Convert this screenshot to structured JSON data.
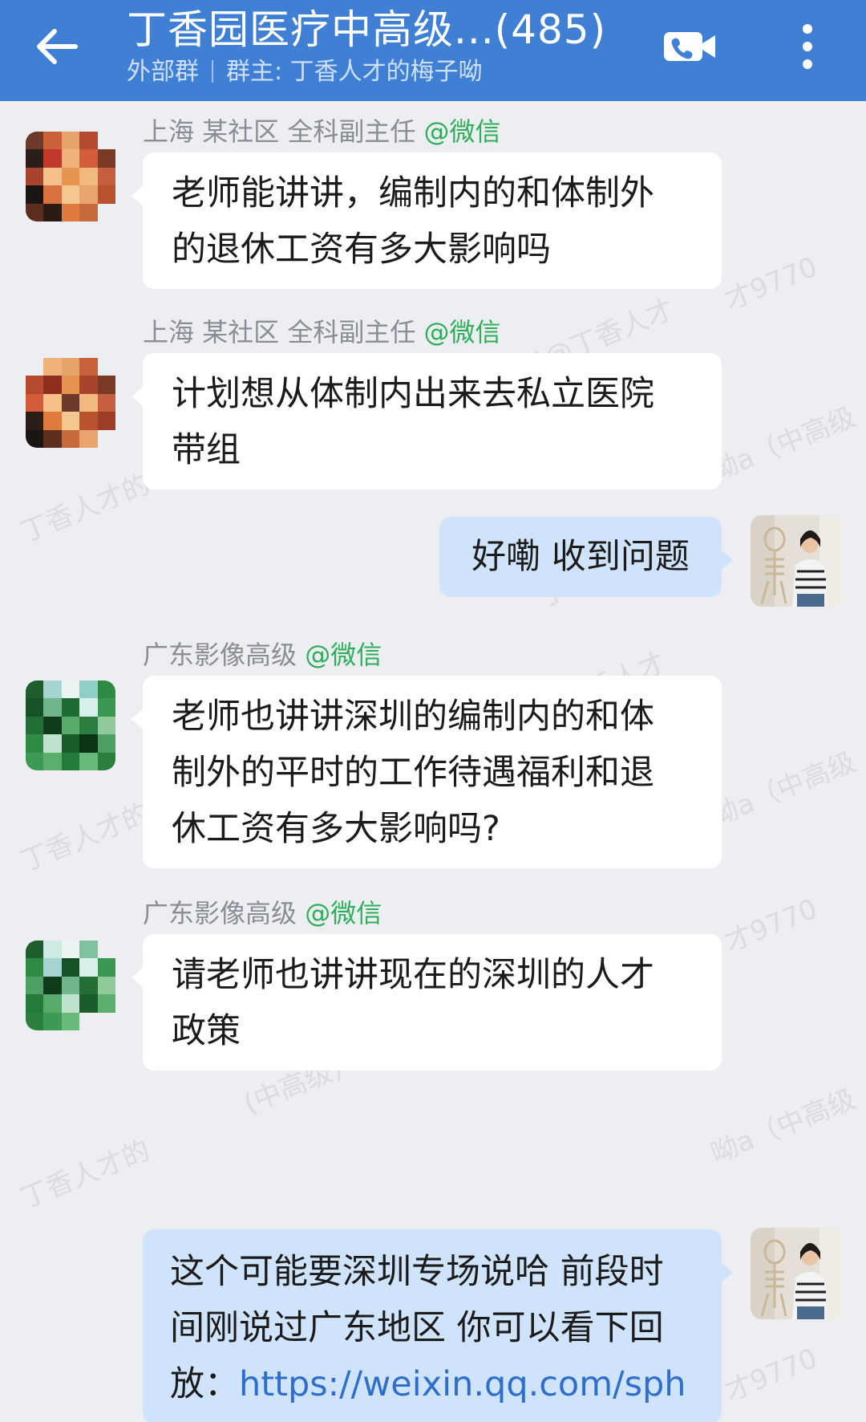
{
  "header": {
    "title": "丁香园医疗中高级...(485)",
    "group_type": "外部群",
    "owner": "群主: 丁香人才的梅子呦",
    "back_icon": "arrow-left-icon",
    "video_icon": "video-call-icon",
    "more_icon": "more-vertical-icon"
  },
  "watermark": {
    "lines": [
      "丁香人才的",
      "的梅子呦)@丁香人才",
      "才9770",
      "呦a（中高级",
      "丁香",
      "(中高级)"
    ]
  },
  "messages": [
    {
      "sender": "上海 某社区 全科副主任",
      "tag": "@微信",
      "text_lines": [
        "老师能讲讲，编制内的和体制外",
        "的退休工资有多大影响吗"
      ]
    },
    {
      "sender": "上海 某社区 全科副主任",
      "tag": "@微信",
      "text_lines": [
        "计划想从体制内出来去私立医院",
        "带组"
      ]
    },
    {
      "text": "好嘞 收到问题"
    },
    {
      "sender": "广东影像高级",
      "tag": "@微信",
      "text_lines": [
        "老师也讲讲深圳的编制内的和体",
        "制外的平时的工作待遇福利和退",
        "休工资有多大影响吗?"
      ]
    },
    {
      "sender": "广东影像高级",
      "tag": "@微信",
      "text_lines": [
        "请老师也讲讲现在的深圳的人才",
        "政策"
      ]
    },
    {
      "text_lines": [
        "这个可能要深圳专场说哈 前段时",
        "间刚说过广东地区 你可以看下回"
      ],
      "link_prefix": "放：",
      "link": "https://weixin.qq.com/sph"
    }
  ],
  "colors": {
    "header": "#3f7fd4",
    "background": "#eceef2",
    "outgoing_bubble": "#cfe3fb",
    "wechat_tag": "#2fae5a",
    "link": "#2f6fc9"
  }
}
